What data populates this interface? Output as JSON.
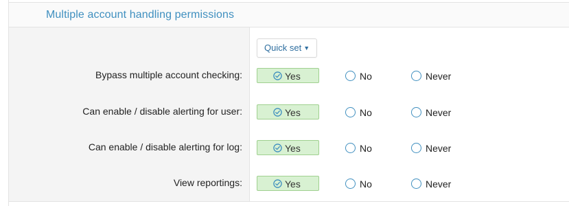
{
  "section": {
    "title": "Multiple account handling permissions"
  },
  "quick_set": {
    "label": "Quick set"
  },
  "options": {
    "yes": "Yes",
    "no": "No",
    "never": "Never"
  },
  "permissions": [
    {
      "label": "Bypass multiple account checking:",
      "selected": "Yes"
    },
    {
      "label": "Can enable / disable alerting for user:",
      "selected": "Yes"
    },
    {
      "label": "Can enable / disable alerting for log:",
      "selected": "Yes"
    },
    {
      "label": "View reportings:",
      "selected": "Yes"
    }
  ],
  "colors": {
    "title": "#3f8fbf",
    "selected_bg": "#d8f1d2",
    "selected_border": "#9fd08f",
    "radio": "#3f8fbf"
  }
}
